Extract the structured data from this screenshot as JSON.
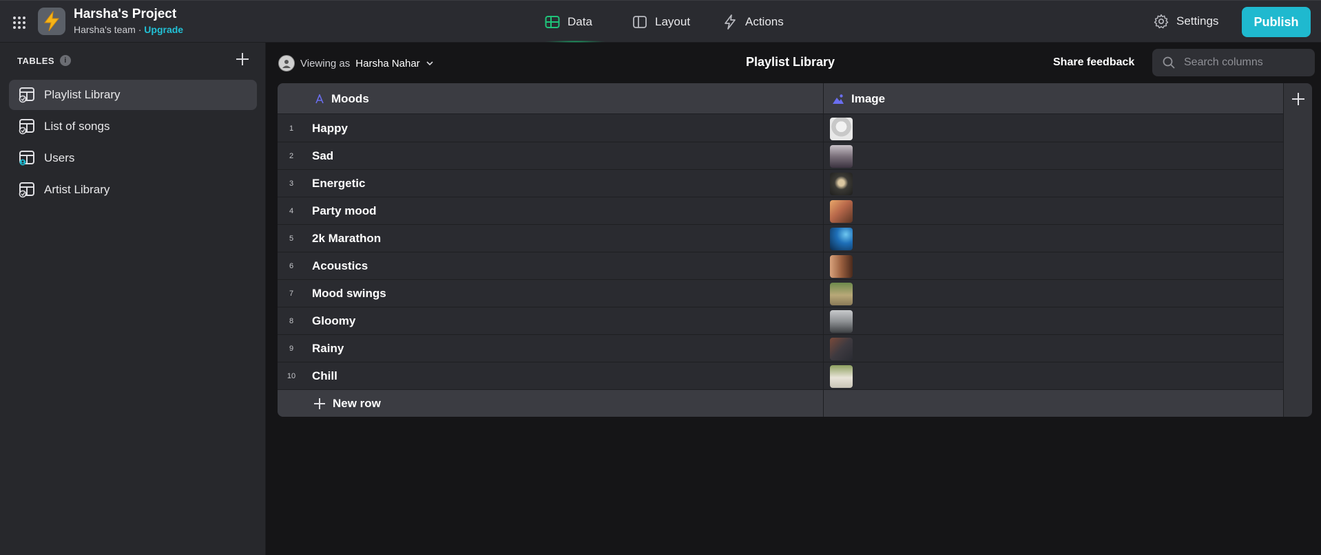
{
  "header": {
    "project_title": "Harsha's Project",
    "team": "Harsha's team",
    "separator": " · ",
    "upgrade": "Upgrade",
    "tabs": [
      {
        "label": "Data",
        "icon": "data-grid-icon",
        "active": true
      },
      {
        "label": "Layout",
        "icon": "layout-icon",
        "active": false
      },
      {
        "label": "Actions",
        "icon": "bolt-icon",
        "active": false
      }
    ],
    "settings_label": "Settings",
    "publish_label": "Publish",
    "accent_color": "#1fb9cf",
    "active_tab_color": "#19b46e"
  },
  "sidebar": {
    "section_title": "TABLES",
    "items": [
      {
        "label": "Playlist Library",
        "active": true
      },
      {
        "label": "List of songs",
        "active": false
      },
      {
        "label": "Users",
        "active": false
      },
      {
        "label": "Artist Library",
        "active": false
      }
    ]
  },
  "toolbar": {
    "viewing_prefix": "Viewing as",
    "viewing_user": "Harsha Nahar",
    "page_title": "Playlist Library",
    "share_feedback": "Share feedback",
    "search_placeholder": "Search columns"
  },
  "grid": {
    "columns": [
      {
        "label": "Moods",
        "icon": "text-column-icon"
      },
      {
        "label": "Image",
        "icon": "image-column-icon"
      }
    ],
    "rows": [
      {
        "num": "1",
        "mood": "Happy"
      },
      {
        "num": "2",
        "mood": "Sad"
      },
      {
        "num": "3",
        "mood": "Energetic"
      },
      {
        "num": "4",
        "mood": "Party mood"
      },
      {
        "num": "5",
        "mood": "2k Marathon"
      },
      {
        "num": "6",
        "mood": "Acoustics"
      },
      {
        "num": "7",
        "mood": "Mood swings"
      },
      {
        "num": "8",
        "mood": "Gloomy"
      },
      {
        "num": "9",
        "mood": "Rainy"
      },
      {
        "num": "10",
        "mood": "Chill"
      }
    ],
    "new_row_label": "New row"
  }
}
